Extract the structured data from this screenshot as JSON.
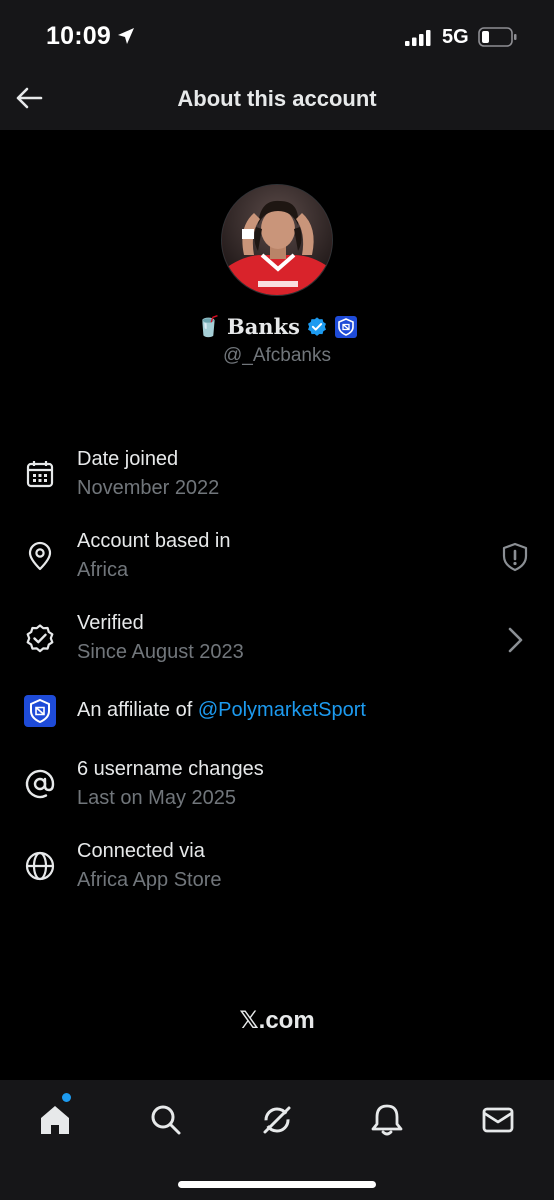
{
  "status_bar": {
    "time": "10:09",
    "network": "5G"
  },
  "header": {
    "title": "About this account"
  },
  "profile": {
    "emoji": "🥤",
    "name": "Banks",
    "handle": "@_Afcbanks"
  },
  "rows": {
    "date_joined": {
      "title": "Date joined",
      "subtitle": "November 2022"
    },
    "based_in": {
      "title": "Account based in",
      "subtitle": "Africa"
    },
    "verified": {
      "title": "Verified",
      "subtitle": "Since August 2023"
    },
    "affiliate": {
      "prefix": "An affiliate of ",
      "link": "@PolymarketSport"
    },
    "username_changes": {
      "title": "6 username changes",
      "subtitle": "Last on May 2025"
    },
    "connected_via": {
      "title": "Connected via",
      "subtitle": "Africa App Store"
    }
  },
  "footer": {
    "brand": "𝕏.com"
  },
  "tabs": [
    "home-icon",
    "search-icon",
    "grok-icon",
    "notifications-icon",
    "messages-icon"
  ],
  "colors": {
    "background": "#000000",
    "header_background": "#161618",
    "accent": "#1d9bf0",
    "primary_text": "#e7e9ea",
    "secondary_text": "#71767b"
  }
}
